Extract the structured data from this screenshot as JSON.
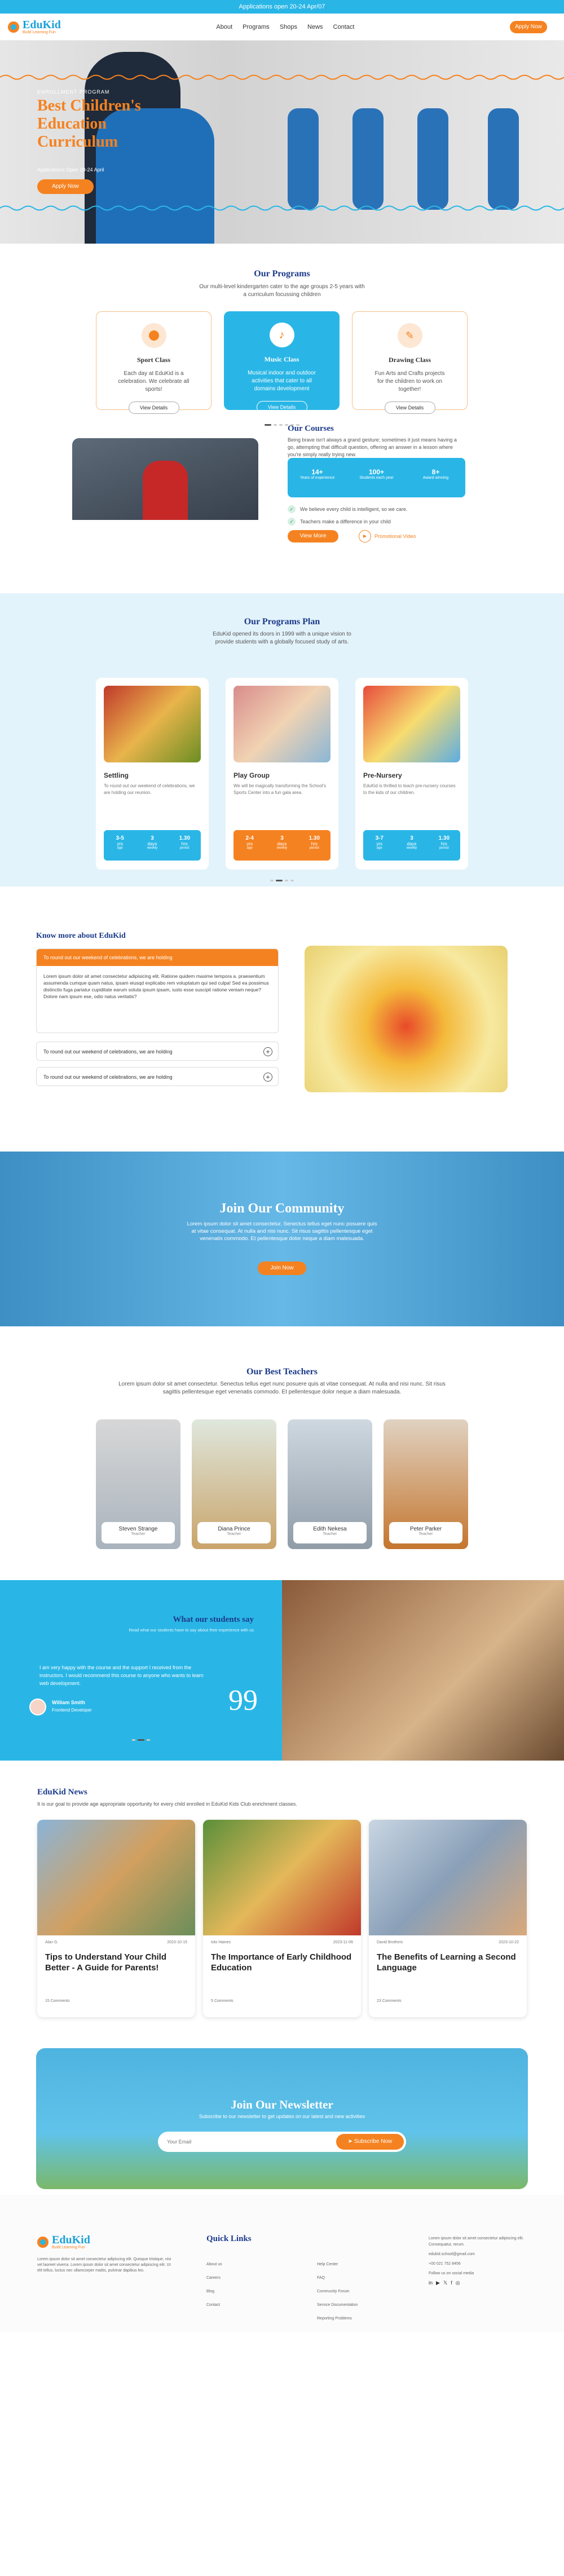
{
  "topbar": {
    "text": "Applications open 20-24 Apr/07"
  },
  "brand": {
    "name": "EduKid",
    "tagline": "Build Learning Fun"
  },
  "nav": [
    "About",
    "Programs",
    "Shops",
    "News",
    "Contact"
  ],
  "header_cta": "Apply Now",
  "hero": {
    "eyebrow": "ENROLLMENT PROGRAM",
    "title": "Best Children's Education Curriculum",
    "note": "Applications Open 20-24 April",
    "cta": "Apply Now"
  },
  "programs": {
    "title": "Our Programs",
    "subtitle": "Our multi-level kindergarten cater to the age groups 2-5 years with a curriculum focussing children",
    "items": [
      {
        "name": "Sport Class",
        "text": "Each day at EduKid is a celebration. We celebrate all sports!",
        "cta": "View Details"
      },
      {
        "name": "Music Class",
        "text": "Musical indoor and outdoor activities that cater to all domains development",
        "cta": "View Details"
      },
      {
        "name": "Drawing Class",
        "text": "Fun Arts and Crafts projects for the children to work on together!",
        "cta": "View Details"
      }
    ]
  },
  "courses": {
    "title": "Our Courses",
    "text": "Being brave isn't always a grand gesture; sometimes it just means having a go, attempting that difficult question, offering an answer in a lesson where you're simply really trying new.",
    "stats": [
      {
        "value": "14+",
        "label": "Years of experience"
      },
      {
        "value": "100+",
        "label": "Students each year"
      },
      {
        "value": "8+",
        "label": "Award winning"
      }
    ],
    "bullets": [
      "We believe every child is intelligent, so we care.",
      "Teachers make a difference in your child"
    ],
    "cta": "View More",
    "video": "Promotional Video"
  },
  "plan": {
    "title": "Our Programs Plan",
    "subtitle": "EduKid opened its doors in 1999 with a unique vision to provide students with a globally focused study of arts.",
    "items": [
      {
        "name": "Settling",
        "text": "To round out our weekend of celebrations, we are holding our reunion.",
        "color": "#29b6e6",
        "stats": [
          [
            "3-5",
            "yrs",
            "age"
          ],
          [
            "3",
            "days",
            "weekly"
          ],
          [
            "1.30",
            "hrs",
            "period"
          ]
        ]
      },
      {
        "name": "Play Group",
        "text": "We will be magically transforming the School's Sports Center into a fun gala area.",
        "color": "#f58220",
        "stats": [
          [
            "2-4",
            "yrs",
            "age"
          ],
          [
            "3",
            "days",
            "weekly"
          ],
          [
            "1.30",
            "hrs",
            "period"
          ]
        ]
      },
      {
        "name": "Pre-Nursery",
        "text": "EduKid is thrilled to teach pre-nursery courses to the kids of our children.",
        "color": "#29b6e6",
        "stats": [
          [
            "3-7",
            "yrs",
            "age"
          ],
          [
            "3",
            "days",
            "weekly"
          ],
          [
            "1.30",
            "hrs",
            "period"
          ]
        ]
      }
    ]
  },
  "faq": {
    "title": "Know more about EduKid",
    "open_q": "To round out our weekend of celebrations, we are holding",
    "open_a": "Lorem ipsum dolor sit amet consectetur adipisicing elit. Ratione quidem maxime tempora a. praesentium assumenda cumque quam natus, ipsam eiusqd explicabo rem voluptatum qui sed culpa! Sed ea possimus distinctio fuga pariatur cupiditate earum soluta ipsum ipsam, iusto esse suscipit ratione veniam neque? Dolore nam ipsum ese, odio natus veritatis?",
    "closed": [
      "To round out our weekend of celebrations, we are holding",
      "To round out our weekend of celebrations, we are holding"
    ]
  },
  "community": {
    "title": "Join Our Community",
    "text": "Lorem ipsum dolor sit amet consectetur. Senectus tellus eget nunc posuere quis at vitae consequat. At nulla and nisi nunc. Sit risus sagittis pellentesque eget venenatis commodo. Et pellentesque dolor neque a diam malesuada.",
    "cta": "Join Now"
  },
  "teachers": {
    "title": "Our Best Teachers",
    "subtitle": "Lorem ipsum dolor sit amet consectetur. Senectus tellus eget nunc posuere quis at vitae consequat. At nulla and nisi nunc. Sit risus sagittis pellentesque eget venenatis commodo. Et pellentesque dolor neque a diam malesuada.",
    "items": [
      {
        "name": "Steven Strange",
        "role": "Teacher"
      },
      {
        "name": "Diana Prince",
        "role": "Teacher"
      },
      {
        "name": "Edith Nekesa",
        "role": "Teacher"
      },
      {
        "name": "Peter Parker",
        "role": "Teacher"
      }
    ]
  },
  "testimonial": {
    "title": "What our students say",
    "subtitle": "Read what our students have to say about their experience with us",
    "quote": "I am very happy with the course and the support I received from the instructors. I would recommend this course to anyone who wants to learn web development.",
    "name": "William Smith",
    "role": "Frontend Developer"
  },
  "news": {
    "title": "EduKid News",
    "subtitle": "It is our goal to provide age appropriate opportunity for every child enrolled in EduKid Kids Club enrichment classes.",
    "items": [
      {
        "author": "Alan G.",
        "date": "2023-10-15",
        "title": "Tips to Understand Your Child Better - A Guide for Parents!",
        "comments": "15 Comments"
      },
      {
        "author": "Iolo Haines",
        "date": "2023-11-06",
        "title": "The Importance of Early Childhood Education",
        "comments": "5 Comments"
      },
      {
        "author": "David Brothers",
        "date": "2023-10-22",
        "title": "The Benefits of Learning a Second Language",
        "comments": "23 Comments"
      }
    ]
  },
  "newsletter": {
    "title": "Join Our Newsletter",
    "subtitle": "Subscribe to our newsletter to get updates on our latest and new activities",
    "placeholder": "Your Email",
    "cta": "Subscribe Now"
  },
  "footer": {
    "desc": "Lorem ipsum dolor sit amet consectetur adipiscing elit. Quisque tristique, nisi vel laoreet viverra. Lorem ipsum dolor sit amet consectetur adipiscing elit. Ut elit tellus, luctus nec ullamcorper mattis, pulvinar dapibus leo.",
    "links_title": "Quick Links",
    "links_a": [
      "About us",
      "Careers",
      "Blog",
      "Contact"
    ],
    "links_b": [
      "Help Center",
      "FAQ",
      "Community Forum",
      "Service Documentation",
      "Reporting Problems"
    ],
    "contact": [
      "Lorem ipsum dolor sit amet consectetur adipiscing elit. Consequatur, rerum.",
      "edukid.school@gmail.com",
      "+00 021 752 8456",
      "Follow us on social media"
    ]
  }
}
